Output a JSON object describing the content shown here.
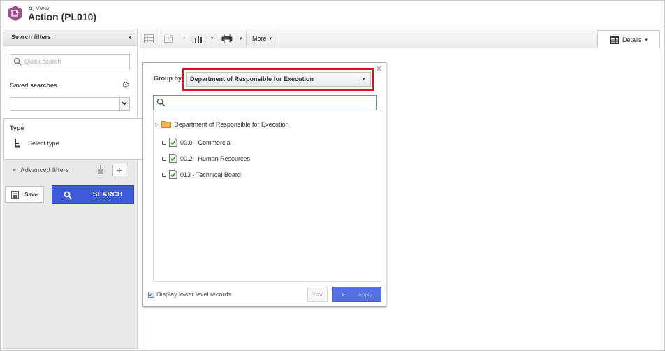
{
  "header": {
    "view_label": "View",
    "title": "Action (PL010)"
  },
  "sidebar": {
    "search_filters_label": "Search filters",
    "quick_search_placeholder": "Quick search",
    "saved_searches_label": "Saved searches",
    "saved_searches_value": "",
    "type_label": "Type",
    "select_type_label": "Select type",
    "advanced_filters_label": "Advanced filters",
    "save_label": "Save",
    "search_label": "SEARCH"
  },
  "toolbar": {
    "more_label": "More",
    "details_label": "Details"
  },
  "popup": {
    "group_by_label": "Group by",
    "group_by_value": "Department of Responsible for Execution",
    "search_value": "",
    "tree": {
      "root_label": "Department of Responsible for Execution",
      "items": [
        {
          "label": "00.0 - Commercial"
        },
        {
          "label": "00.2 - Human Resources"
        },
        {
          "label": "013 - Technical Board"
        }
      ]
    },
    "display_lower_label": "Display lower level records",
    "display_lower_checked": true,
    "view_label": "View",
    "apply_label": "Apply"
  },
  "colors": {
    "app_icon": "#a04d8e",
    "search_button": "#3d5ad8",
    "highlight": "#d6161c"
  }
}
